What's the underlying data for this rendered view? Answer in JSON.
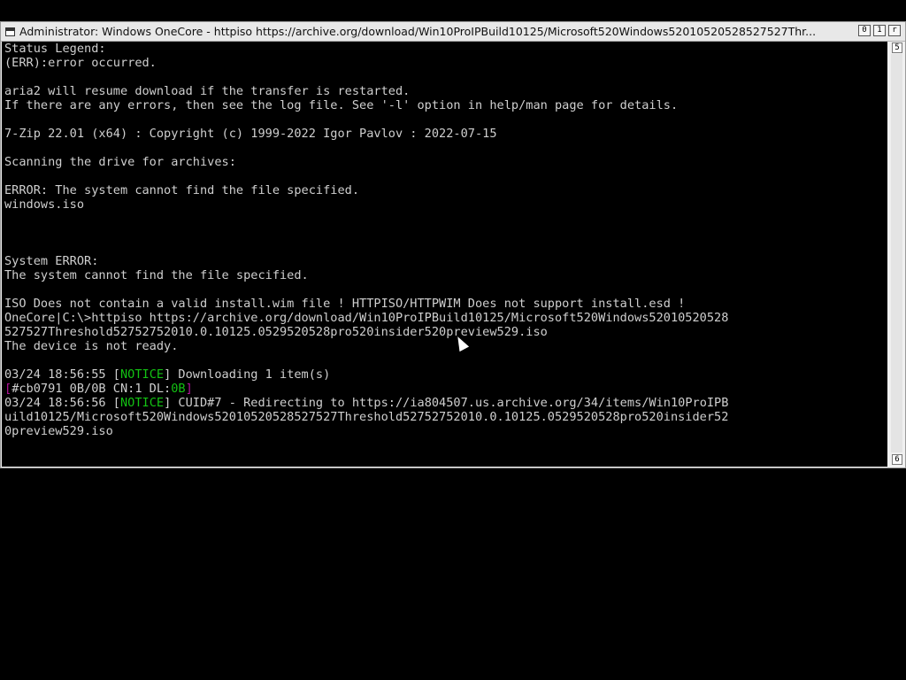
{
  "window": {
    "title": "Administrator:  Windows OneCore - httpiso  https://archive.org/download/Win10ProIPBuild10125/Microsoft520Windows52010520528527527Thr...",
    "buttons": {
      "minimize": "0",
      "maximize": "1",
      "close": "r"
    }
  },
  "scrollbar": {
    "up_arrow": "5",
    "down_arrow": "6"
  },
  "console": {
    "lines": [
      "Status Legend:",
      "(ERR):error occurred.",
      "",
      "aria2 will resume download if the transfer is restarted.",
      "If there are any errors, then see the log file. See '-l' option in help/man page for details.",
      "",
      "7-Zip 22.01 (x64) : Copyright (c) 1999-2022 Igor Pavlov : 2022-07-15",
      "",
      "Scanning the drive for archives:",
      "",
      "ERROR: The system cannot find the file specified.",
      "windows.iso",
      "",
      "",
      "",
      "System ERROR:",
      "The system cannot find the file specified.",
      "",
      "ISO Does not contain a valid install.wim file ! HTTPISO/HTTPWIM Does not support install.esd !",
      "OneCore|C:\\>httpiso https://archive.org/download/Win10ProIPBuild10125/Microsoft520Windows52010520528",
      "527527Threshold52752752010.0.10125.0529520528pro520insider520preview529.iso",
      "The device is not ready.",
      "",
      "03/24 18:56:55 [NOTICE] Downloading 1 item(s)",
      "[#cb0791 0B/0B CN:1 DL:0B]",
      "03/24 18:56:56 [NOTICE] CUID#7 - Redirecting to https://ia804507.us.archive.org/34/items/Win10ProIPB",
      "uild10125/Microsoft520Windows52010520528527527Threshold52752752010.0.10125.0529520528pro520insider52",
      "0preview529.iso"
    ],
    "notice_1_prefix": "03/24 18:56:55 [",
    "notice_word": "NOTICE",
    "notice_1_suffix": "] Downloading 1 item(s)",
    "progress_bracket_open": "[",
    "progress_text": "#cb0791 0B/0B CN:1 DL:",
    "progress_dl": "0B",
    "progress_bracket_close": "]",
    "notice_2_prefix": "03/24 18:56:56 [",
    "notice_2_suffix": "] CUID#7 - Redirecting to https://ia804507.us.archive.org/34/items/Win10ProIPB"
  },
  "colors": {
    "notice": "#13c213",
    "progress_bracket": "#b3129a",
    "text": "#cfcfcf"
  }
}
